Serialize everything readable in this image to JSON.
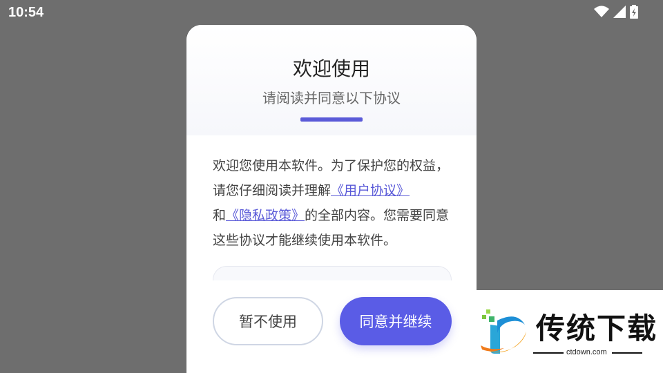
{
  "status_bar": {
    "time": "10:54",
    "icons": [
      "wifi-icon",
      "cellular-signal-icon",
      "battery-icon"
    ]
  },
  "dialog": {
    "title": "欢迎使用",
    "subtitle": "请阅读并同意以下协议",
    "accent_color": "#5a5ad8",
    "body": {
      "part1": "欢迎您使用本软件。为了保护您的权益，请您仔细阅读并理解",
      "link_user_agreement": "《用户协议》",
      "part2": "和",
      "link_privacy_policy": "《隐私政策》",
      "part3": "的全部内容。您需要同意这些协议才能继续使用本软件。"
    },
    "buttons": {
      "decline": "暂不使用",
      "agree": "同意并继续"
    },
    "button_color": "#5a5ce6"
  },
  "watermark": {
    "brand": "传统下载",
    "url": "ctdown.com"
  }
}
